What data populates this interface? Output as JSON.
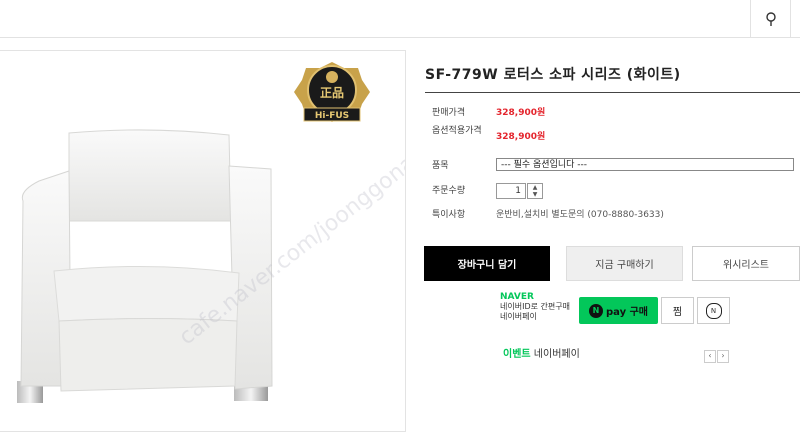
{
  "header": {
    "search_icon": "search-icon",
    "next_icon": "arrow-icon"
  },
  "product": {
    "title": "SF-779W 로터스 소파 시리즈 (화이트)",
    "badge": {
      "main": "正品",
      "sub": "Hi-FUS"
    },
    "watermark": "cafe.naver.com/joonggonara"
  },
  "info": {
    "price_label": "판매가격",
    "price": "328,900원",
    "option_price_label": "옵션적용가격",
    "option_price": "328,900원",
    "option_label": "품목",
    "option_select": "--- 필수 옵션입니다 ---",
    "qty_label": "주문수량",
    "qty_value": "1",
    "note_label": "특이사항",
    "note_value": "운반비,설치비 별도문의 (070-8880-3633)"
  },
  "buttons": {
    "cart": "장바구니 담기",
    "buy_now": "지금 구매하기",
    "wishlist": "위시리스트"
  },
  "naver": {
    "logo": "NAVER",
    "desc1": "네이버ID로 간편구매",
    "desc2": "네이버페이",
    "pay_button": "pay 구매",
    "pay_mark": "N",
    "zzim": "찜",
    "talk_mark": "N",
    "event_label": "이벤트",
    "event_text": "네이버페이"
  }
}
